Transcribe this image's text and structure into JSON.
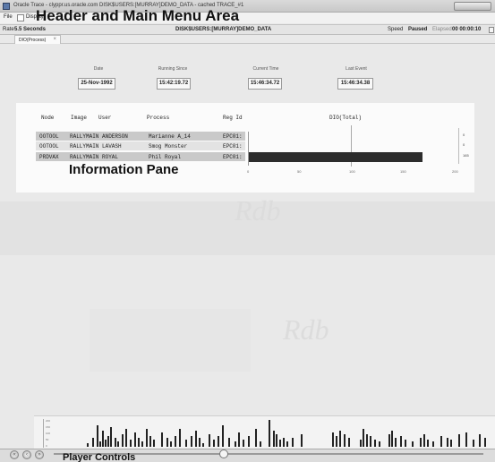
{
  "window": {
    "title": "Oracle Trace - clyppr.us.oracle.com DISK$USERS:[MURRAY]DEMO_DATA - cached TRACE_#1"
  },
  "menu": {
    "file": "File",
    "display": "Display"
  },
  "overlays": {
    "header": "Header and Main Menu Area",
    "info": "Information Pane",
    "player": "Player Controls"
  },
  "status": {
    "rate_label": "Rate",
    "rate_value": "5.5 Seconds",
    "data_path": "DISK$USERS:[MURRAY]DEMO_DATA",
    "speed_label": "Speed",
    "state": "Paused",
    "elapsed_label": "Elapsed",
    "elapsed_value": "00 00:00:10"
  },
  "tab": {
    "label": "DIO(Process)",
    "close": "×"
  },
  "info": {
    "date_label": "Date",
    "date_value": "25-Nov-1992",
    "running_label": "Running Since",
    "running_value": "15:42:19.72",
    "current_label": "Current Time",
    "current_value": "15:46:34.72",
    "last_label": "Last Event",
    "last_value": "15:46:34.38"
  },
  "table": {
    "headers": {
      "node": "Node",
      "image": "Image",
      "user": "User",
      "process": "Process",
      "reg_id": "Reg Id",
      "dio": "DIO(Total)"
    },
    "rows": [
      {
        "node": "OOTOOL",
        "image": "RALLYMAIN",
        "user": "ANDERSON",
        "process": "Marianne A_14",
        "reg_id": "EPC01:"
      },
      {
        "node": "OOTOOL",
        "image": "RALLYMAIN",
        "user": "LAVASH",
        "process": "Smog Monster",
        "reg_id": "EPC01:"
      },
      {
        "node": "PRDVAX",
        "image": "RALLYMAIN",
        "user": "ROYAL",
        "process": "Phil Royal",
        "reg_id": "EPC01:"
      }
    ],
    "side_labels": [
      "0",
      "0",
      "165"
    ],
    "dio_values": [
      0,
      0,
      165
    ],
    "axis_max": 200,
    "ticks": [
      "0",
      "50",
      "100",
      "150",
      "200"
    ]
  },
  "timeline": {
    "scale": [
      "200",
      "150",
      "100",
      "50",
      "0"
    ]
  },
  "player": {
    "rewind": "«",
    "back": "‹",
    "forward": "»"
  }
}
